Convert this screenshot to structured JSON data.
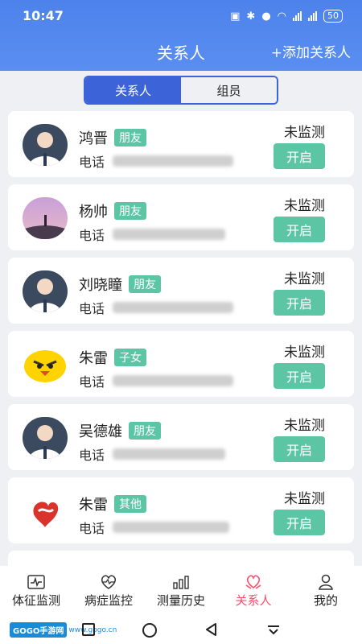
{
  "status_bar": {
    "time": "10:47",
    "battery": "50"
  },
  "header": {
    "title": "关系人",
    "add_label": "+添加关系人"
  },
  "segment": {
    "tabs": [
      "关系人",
      "组员"
    ]
  },
  "phone_label": "电话",
  "contacts": [
    {
      "name": "鸿晋",
      "tag": "朋友",
      "status": "未监测",
      "button": "开启",
      "avatar": "person-avatar"
    },
    {
      "name": "杨帅",
      "tag": "朋友",
      "status": "未监测",
      "button": "开启",
      "avatar": "sunset-avatar"
    },
    {
      "name": "刘晓瞳",
      "tag": "朋友",
      "status": "未监测",
      "button": "开启",
      "avatar": "person-avatar"
    },
    {
      "name": "朱雷",
      "tag": "子女",
      "status": "未监测",
      "button": "开启",
      "avatar": "angry-bird-avatar"
    },
    {
      "name": "吴德雄",
      "tag": "朋友",
      "status": "未监测",
      "button": "开启",
      "avatar": "person-avatar"
    },
    {
      "name": "朱雷",
      "tag": "其他",
      "status": "未监测",
      "button": "开启",
      "avatar": "red-logo-avatar"
    }
  ],
  "bottom_nav": [
    {
      "label": "体征监测",
      "icon": "pulse-monitor-icon"
    },
    {
      "label": "病症监控",
      "icon": "heart-pulse-icon"
    },
    {
      "label": "测量历史",
      "icon": "bar-chart-icon"
    },
    {
      "label": "关系人",
      "icon": "heart-hands-icon",
      "active": true
    },
    {
      "label": "我的",
      "icon": "person-icon"
    }
  ],
  "watermark": {
    "badge": "GOGO手游网",
    "sub": "www.gogo.cn"
  },
  "colors": {
    "accent": "#3d63d8",
    "header": "#4d82ec",
    "tag": "#5cc6a4",
    "active_nav": "#ff4d6a"
  }
}
